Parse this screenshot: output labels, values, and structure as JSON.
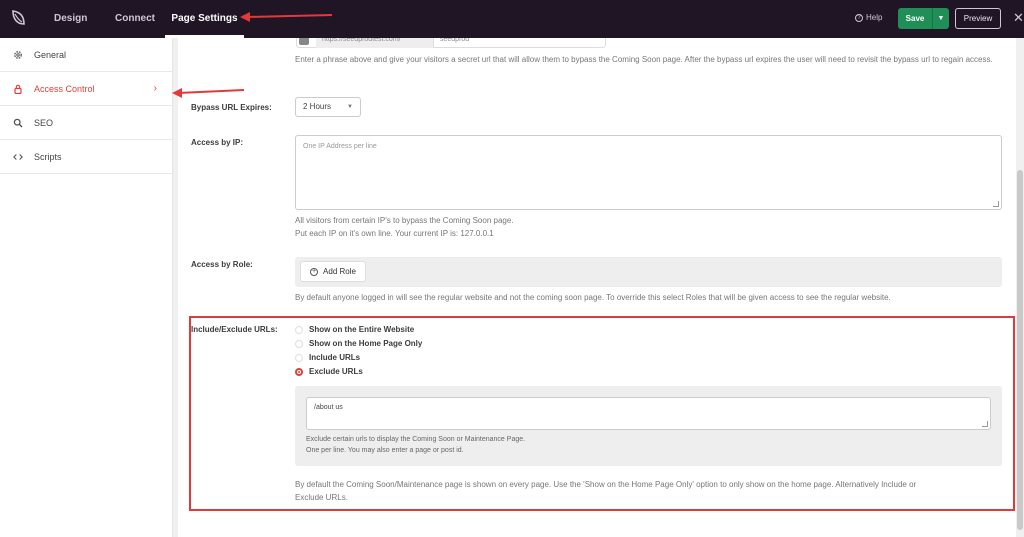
{
  "topbar": {
    "tabs": [
      "Design",
      "Connect",
      "Page Settings"
    ],
    "help_label": "Help",
    "save_label": "Save",
    "preview_label": "Preview",
    "close_symbol": "✕"
  },
  "sidebar": {
    "items": [
      {
        "label": "General",
        "icon": "gear-icon"
      },
      {
        "label": "Access Control",
        "icon": "lock-icon"
      },
      {
        "label": "SEO",
        "icon": "search-icon"
      },
      {
        "label": "Scripts",
        "icon": "code-icon"
      }
    ]
  },
  "bypass": {
    "url_prefix": "https://seedprodtest.com/",
    "url_value": "seedprod",
    "help": "Enter a phrase above and give your visitors a secret url that will allow them to bypass the Coming Soon page. After the bypass url expires the user will need to revisit the bypass url to regain access.",
    "expires_label": "Bypass URL Expires:",
    "expires_value": "2 Hours"
  },
  "ip": {
    "label": "Access by IP:",
    "placeholder": "One IP Address per line",
    "help_line1": "All visitors from certain IP's to bypass the Coming Soon page.",
    "help_line2": "Put each IP on it's own line. Your current IP is: 127.0.0.1"
  },
  "role": {
    "label": "Access by Role:",
    "add_label": "Add Role",
    "help": "By default anyone logged in will see the regular website and not the coming soon page. To override this select Roles that will be given access to see the regular website."
  },
  "urls": {
    "label": "Include/Exclude URLs:",
    "options": [
      "Show on the Entire Website",
      "Show on the Home Page Only",
      "Include URLs",
      "Exclude URLs"
    ],
    "selected": "Exclude URLs",
    "exclude_value": "/about us",
    "exclude_help_line1": "Exclude certain urls to display the Coming Soon or Maintenance Page.",
    "exclude_help_line2": "One per line. You may also enter a page or post id.",
    "footer_line1": "By default the Coming Soon/Maintenance page is shown on every page. Use the 'Show on the Home Page Only' option to only show on the home page. Alternatively Include or",
    "footer_line2": "Exclude URLs."
  },
  "colors": {
    "topbar": "#1f1525",
    "accent_red": "#e0413a",
    "save_green": "#1f8f57"
  }
}
